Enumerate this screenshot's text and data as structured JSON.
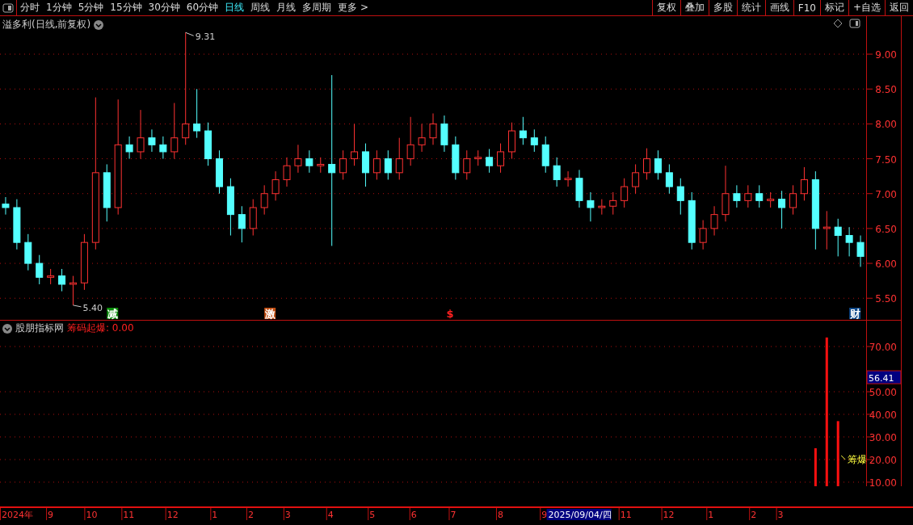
{
  "toolbar": {
    "periods": [
      {
        "label": "分时",
        "selected": false
      },
      {
        "label": "1分钟",
        "selected": false
      },
      {
        "label": "5分钟",
        "selected": false
      },
      {
        "label": "15分钟",
        "selected": false
      },
      {
        "label": "30分钟",
        "selected": false
      },
      {
        "label": "60分钟",
        "selected": false
      },
      {
        "label": "日线",
        "selected": true
      },
      {
        "label": "周线",
        "selected": false
      },
      {
        "label": "月线",
        "selected": false
      },
      {
        "label": "多周期",
        "selected": false
      },
      {
        "label": "更多 >",
        "selected": false
      }
    ],
    "buttons": [
      "复权",
      "叠加",
      "多股",
      "统计",
      "画线",
      "F10",
      "标记",
      "+自选",
      "返回"
    ]
  },
  "price_panel": {
    "title": "溢多利(日线,前复权)",
    "chart_data": {
      "type": "candlestick",
      "grid": true,
      "ylim": [
        5.19,
        9.545
      ],
      "yticks": [
        {
          "value": 5.5,
          "label": "5.50"
        },
        {
          "value": 6,
          "label": "6.00"
        },
        {
          "value": 6.5,
          "label": "6.50"
        },
        {
          "value": 7,
          "label": "7.00"
        },
        {
          "value": 7.5,
          "label": "7.50"
        },
        {
          "value": 8,
          "label": "8.00"
        },
        {
          "value": 8.5,
          "label": "8.50"
        },
        {
          "value": 9,
          "label": "9.00"
        }
      ],
      "ohlc": [
        [
          6.85,
          6.95,
          6.7,
          6.8
        ],
        [
          6.8,
          6.92,
          6.2,
          6.3
        ],
        [
          6.3,
          6.42,
          5.9,
          6.0
        ],
        [
          6.0,
          6.12,
          5.7,
          5.8
        ],
        [
          5.8,
          5.92,
          5.7,
          5.82
        ],
        [
          5.82,
          5.92,
          5.6,
          5.7
        ],
        [
          5.7,
          5.82,
          5.4,
          5.72
        ],
        [
          5.72,
          6.42,
          5.62,
          6.3
        ],
        [
          6.3,
          8.38,
          6.2,
          7.3
        ],
        [
          7.3,
          7.42,
          6.6,
          6.8
        ],
        [
          6.8,
          8.35,
          6.7,
          7.7
        ],
        [
          7.7,
          7.82,
          7.5,
          7.6
        ],
        [
          7.6,
          8.2,
          7.5,
          7.8
        ],
        [
          7.8,
          7.92,
          7.6,
          7.7
        ],
        [
          7.7,
          7.82,
          7.5,
          7.6
        ],
        [
          7.6,
          8.3,
          7.5,
          7.8
        ],
        [
          7.8,
          9.31,
          7.7,
          8.0
        ],
        [
          8.0,
          8.5,
          7.8,
          7.9
        ],
        [
          7.9,
          8.02,
          7.4,
          7.5
        ],
        [
          7.5,
          7.62,
          7.0,
          7.1
        ],
        [
          7.1,
          7.22,
          6.4,
          6.7
        ],
        [
          6.7,
          6.82,
          6.3,
          6.5
        ],
        [
          6.5,
          6.92,
          6.4,
          6.8
        ],
        [
          6.8,
          7.12,
          6.7,
          7.0
        ],
        [
          7.0,
          7.32,
          6.9,
          7.2
        ],
        [
          7.2,
          7.52,
          7.1,
          7.4
        ],
        [
          7.4,
          7.7,
          7.3,
          7.5
        ],
        [
          7.5,
          7.62,
          7.3,
          7.4
        ],
        [
          7.4,
          7.52,
          7.3,
          7.42
        ],
        [
          7.42,
          8.7,
          6.25,
          7.3
        ],
        [
          7.3,
          7.62,
          7.2,
          7.5
        ],
        [
          7.5,
          8.0,
          7.4,
          7.6
        ],
        [
          7.6,
          7.72,
          7.1,
          7.3
        ],
        [
          7.3,
          7.62,
          7.2,
          7.5
        ],
        [
          7.5,
          7.62,
          7.2,
          7.3
        ],
        [
          7.3,
          7.8,
          7.2,
          7.5
        ],
        [
          7.5,
          8.1,
          7.4,
          7.7
        ],
        [
          7.7,
          8.0,
          7.6,
          7.8
        ],
        [
          7.8,
          8.15,
          7.7,
          8.0
        ],
        [
          8.0,
          8.12,
          7.6,
          7.7
        ],
        [
          7.7,
          7.82,
          7.2,
          7.3
        ],
        [
          7.3,
          7.62,
          7.2,
          7.5
        ],
        [
          7.5,
          7.62,
          7.4,
          7.52
        ],
        [
          7.52,
          7.64,
          7.3,
          7.4
        ],
        [
          7.4,
          7.72,
          7.3,
          7.6
        ],
        [
          7.6,
          8.02,
          7.5,
          7.9
        ],
        [
          7.9,
          8.1,
          7.7,
          7.8
        ],
        [
          7.8,
          7.92,
          7.6,
          7.7
        ],
        [
          7.7,
          7.82,
          7.3,
          7.4
        ],
        [
          7.4,
          7.52,
          7.1,
          7.2
        ],
        [
          7.2,
          7.32,
          7.1,
          7.22
        ],
        [
          7.22,
          7.34,
          6.8,
          6.9
        ],
        [
          6.9,
          7.02,
          6.6,
          6.8
        ],
        [
          6.8,
          6.92,
          6.7,
          6.82
        ],
        [
          6.82,
          7.02,
          6.7,
          6.9
        ],
        [
          6.9,
          7.22,
          6.8,
          7.1
        ],
        [
          7.1,
          7.42,
          7.0,
          7.3
        ],
        [
          7.3,
          7.65,
          7.2,
          7.5
        ],
        [
          7.5,
          7.62,
          7.2,
          7.3
        ],
        [
          7.3,
          7.42,
          7.0,
          7.1
        ],
        [
          7.1,
          7.22,
          6.7,
          6.9
        ],
        [
          6.9,
          7.02,
          6.2,
          6.3
        ],
        [
          6.3,
          6.62,
          6.2,
          6.5
        ],
        [
          6.5,
          6.82,
          6.4,
          6.7
        ],
        [
          6.7,
          7.4,
          6.6,
          7.0
        ],
        [
          7.0,
          7.12,
          6.8,
          6.9
        ],
        [
          6.9,
          7.12,
          6.8,
          7.0
        ],
        [
          7.0,
          7.12,
          6.8,
          6.9
        ],
        [
          6.9,
          7.02,
          6.8,
          6.92
        ],
        [
          6.92,
          7.04,
          6.5,
          6.8
        ],
        [
          6.8,
          7.12,
          6.7,
          7.0
        ],
        [
          7.0,
          7.38,
          6.9,
          7.2
        ],
        [
          7.2,
          7.32,
          6.2,
          6.5
        ],
        [
          6.5,
          6.75,
          6.2,
          6.52
        ],
        [
          6.52,
          6.64,
          6.1,
          6.4
        ],
        [
          6.4,
          6.52,
          6.1,
          6.3
        ],
        [
          6.3,
          6.4,
          5.95,
          6.1
        ]
      ],
      "annotations": [
        "9.31",
        "5.40"
      ]
    },
    "cursor_date": "2025/09/04/四",
    "events": [
      {
        "label": "减",
        "kind": "badge",
        "color": "#0a8a0a"
      },
      {
        "label": "激",
        "kind": "badge",
        "color": "#c04c10"
      },
      {
        "label": "$",
        "kind": "text",
        "color": "#ff2020"
      },
      {
        "label": "财",
        "kind": "badge",
        "color": "#104a8a"
      }
    ]
  },
  "time_axis": [
    "2024年",
    "9",
    "10",
    "11",
    "12",
    "1",
    "2",
    "3",
    "4",
    "5",
    "6",
    "7",
    "8",
    "9",
    "11",
    "12",
    "1",
    "2",
    "3"
  ],
  "indicator_panel": {
    "source": "股朋指标网",
    "title": "筹码起爆: 0.00",
    "cursor_value": "56.41",
    "chart_data": {
      "type": "bar",
      "grid": true,
      "ylim": [
        8.2,
        81.8
      ],
      "yticks": [
        {
          "value": 10,
          "label": "10.00"
        },
        {
          "value": 20,
          "label": "20.00"
        },
        {
          "value": 30,
          "label": "30.00"
        },
        {
          "value": 40,
          "label": "40.00"
        },
        {
          "value": 50,
          "label": "50.00"
        },
        {
          "value": 70,
          "label": "70.00"
        }
      ],
      "values": [
        null,
        null,
        null,
        null,
        null,
        null,
        null,
        null,
        null,
        null,
        null,
        null,
        null,
        null,
        null,
        null,
        null,
        null,
        null,
        null,
        null,
        null,
        null,
        null,
        null,
        null,
        null,
        null,
        null,
        null,
        null,
        null,
        null,
        null,
        null,
        null,
        null,
        null,
        null,
        null,
        null,
        null,
        null,
        null,
        null,
        null,
        null,
        null,
        null,
        null,
        null,
        null,
        null,
        null,
        null,
        null,
        null,
        null,
        null,
        null,
        null,
        null,
        null,
        null,
        null,
        null,
        null,
        null,
        null,
        null,
        null,
        null,
        25,
        74,
        37,
        null,
        null
      ],
      "annotations": [
        "筹爆"
      ]
    }
  }
}
